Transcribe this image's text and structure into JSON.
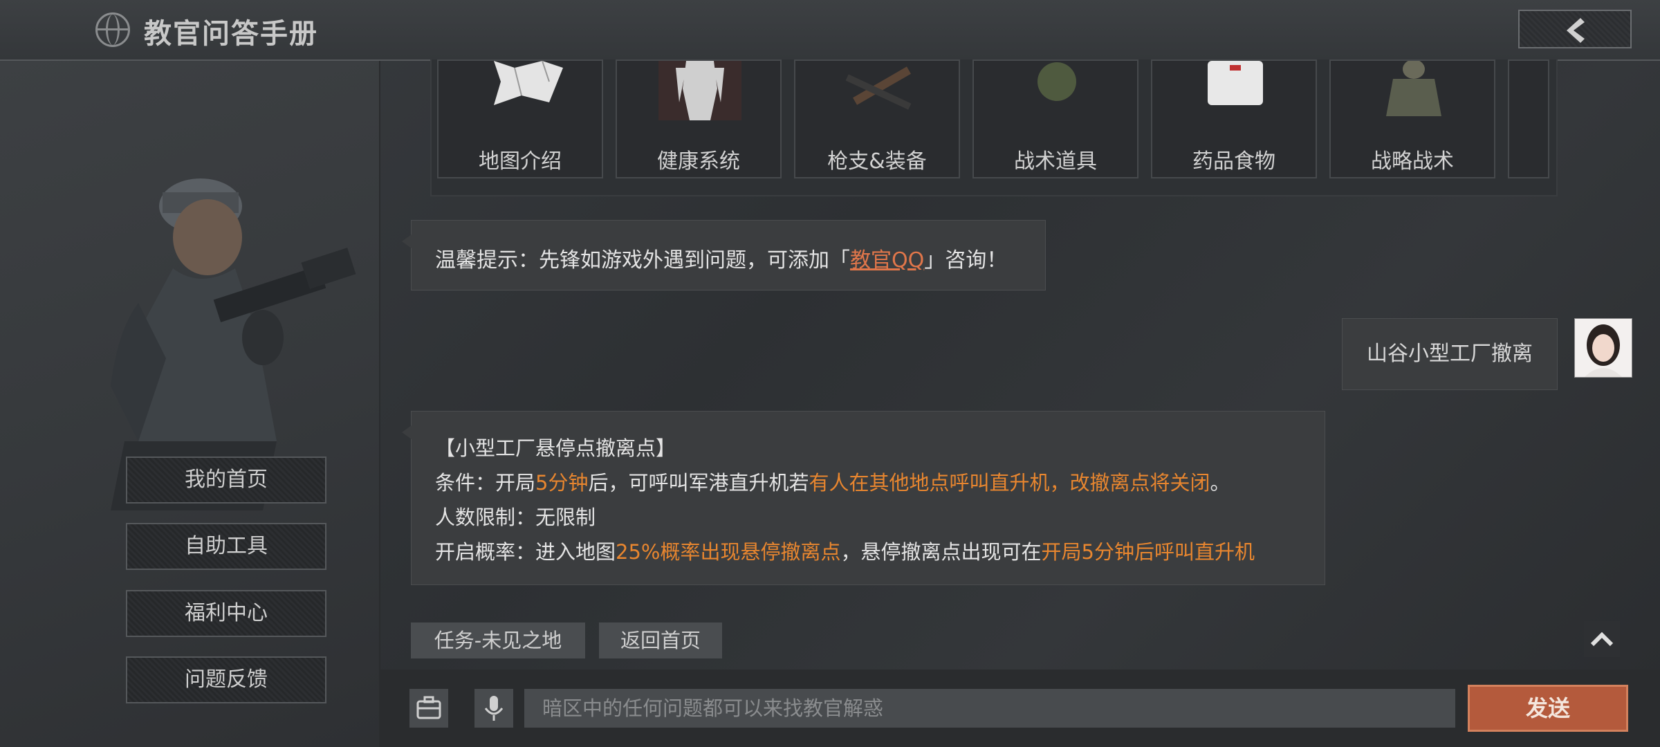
{
  "header": {
    "title": "教官问答手册"
  },
  "sidebar": {
    "items": [
      {
        "label": "我的首页"
      },
      {
        "label": "自助工具"
      },
      {
        "label": "福利中心"
      },
      {
        "label": "问题反馈"
      }
    ]
  },
  "categories": [
    {
      "label": "地图介绍",
      "icon": "map-icon"
    },
    {
      "label": "健康系统",
      "icon": "body-icon"
    },
    {
      "label": "枪支&装备",
      "icon": "rifle-icon"
    },
    {
      "label": "战术道具",
      "icon": "grenade-icon"
    },
    {
      "label": "药品食物",
      "icon": "medkit-icon"
    },
    {
      "label": "战略战术",
      "icon": "soldier-icon"
    }
  ],
  "tip": {
    "prefix": "温馨提示：先锋如游戏外遇到问题，可添加「",
    "link": "教官QQ",
    "suffix": "」咨询！"
  },
  "user_message": "山谷小型工厂撤离",
  "answer": {
    "heading": "【小型工厂悬停点撤离点】",
    "line1_a": "条件：开局",
    "line1_b": "5分钟",
    "line1_c": "后，可呼叫军港直升机若",
    "line1_d": "有人在其他地点呼叫直升机，改撤离点将关闭",
    "line1_e": "。",
    "line2": "人数限制：无限制",
    "line3_a": "开启概率：进入地图",
    "line3_b": "25%概率出现悬停撤离点",
    "line3_c": "，悬停撤离点出现可在",
    "line3_d": "开局5分钟后呼叫直升机"
  },
  "quick_replies": [
    "任务-未见之地",
    "返回首页"
  ],
  "input": {
    "placeholder": "暗区中的任何问题都可以来找教官解惑"
  },
  "send_label": "发送",
  "colors": {
    "accent": "#b45a3c",
    "highlight": "#e8862f",
    "link": "#e0764a"
  }
}
